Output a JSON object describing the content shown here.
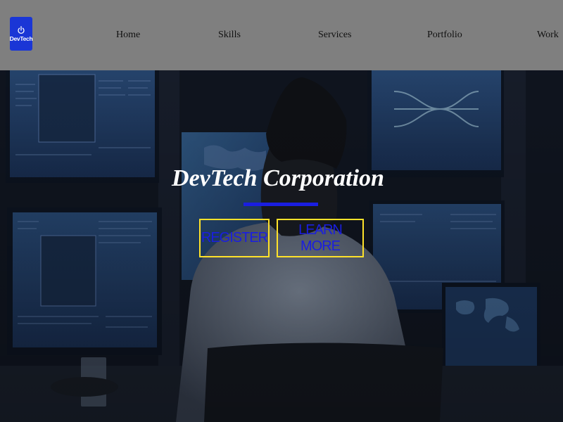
{
  "brand": {
    "logo_text": "DevTech",
    "logo_icon": "power-icon"
  },
  "nav": {
    "items": [
      {
        "label": "Home"
      },
      {
        "label": "Skills"
      },
      {
        "label": "Services"
      },
      {
        "label": "Portfolio"
      },
      {
        "label": "Work"
      }
    ]
  },
  "hero": {
    "title": "DevTech Corporation",
    "register_label": "REGISTER",
    "learn_more_label": "LEARN MORE"
  },
  "colors": {
    "header_bg": "#7f7f7f",
    "logo_bg": "#1a36d6",
    "accent_blue": "#1a1ee0",
    "button_border": "#ffe22a"
  }
}
